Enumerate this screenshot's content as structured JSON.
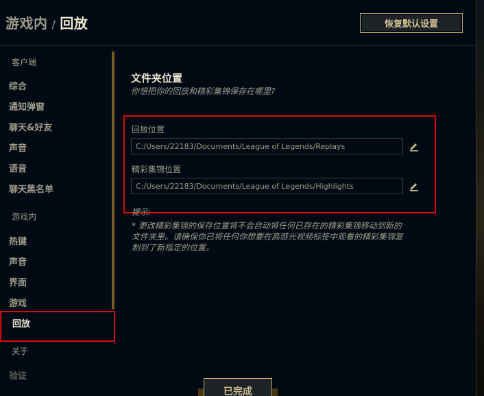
{
  "header": {
    "breadcrumb_parent": "游戏内",
    "breadcrumb_separator": "/",
    "breadcrumb_current": "回放",
    "reset_button": "恢复默认设置"
  },
  "sidebar": {
    "group_client": "客户端",
    "client_items": [
      {
        "label": "综合"
      },
      {
        "label": "通知弹窗"
      },
      {
        "label": "聊天&好友"
      },
      {
        "label": "声音"
      },
      {
        "label": "语音"
      },
      {
        "label": "聊天黑名单"
      }
    ],
    "group_ingame": "游戏内",
    "ingame_items": [
      {
        "label": "热键"
      },
      {
        "label": "声音"
      },
      {
        "label": "界面"
      },
      {
        "label": "游戏"
      },
      {
        "label": "回放"
      }
    ],
    "about": "关于",
    "verify": "验证"
  },
  "main": {
    "section_title": "文件夹位置",
    "section_subtitle": "你想把你的回放和精彩集锦保存在哪里?",
    "replays_label": "回放位置",
    "replays_path": "C:/Users/22183/Documents/League of Legends/Replays",
    "highlights_label": "精彩集锦位置",
    "highlights_path": "C:/Users/22183/Documents/League of Legends/Highlights",
    "tip_label": "提示:",
    "tip_text": "* 更改精彩集锦的保存位置将不会自动将任何已存在的精彩集锦移动到新的文件夹里。请确保你已将任何你想要在高感光视频标签中观看的精彩集锦复制到了新指定的位置。"
  },
  "footer": {
    "done_button": "已完成"
  },
  "colors": {
    "background": "#010a13",
    "gold": "#c8aa6e",
    "text_muted": "#a09b8c",
    "text_bright": "#f0e6d2",
    "highlight_red": "#d40c0c"
  },
  "icons": {
    "edit": "pencil-icon"
  }
}
